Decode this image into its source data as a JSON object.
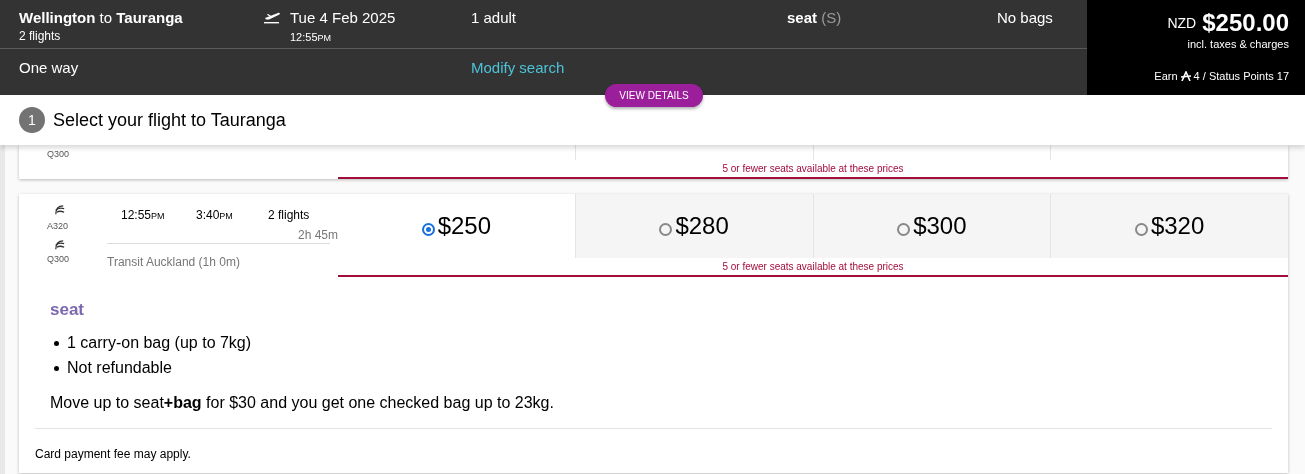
{
  "summary": {
    "origin": "Wellington",
    "connector": "to",
    "destination": "Tauranga",
    "flights_count": "2 flights",
    "date": "Tue 4 Feb 2025",
    "time": "12:55",
    "period": "PM",
    "passengers": "1 adult",
    "fare_name": "seat",
    "fare_code": "(S)",
    "bags": "No bags",
    "trip_type": "One way",
    "modify_link": "Modify search"
  },
  "price": {
    "currency": "NZD",
    "amount": "$250.00",
    "note": "incl. taxes & charges",
    "earn_prefix": "Earn",
    "earn_text": "4 / Status Points 17"
  },
  "view_details": "VIEW DETAILS",
  "step": {
    "number": "1",
    "title": "Select your flight to Tauranga"
  },
  "flights": [
    {
      "aircraft": [
        "Q300"
      ],
      "warning": "5 or fewer seats available at these prices"
    },
    {
      "aircraft": [
        "A320",
        "Q300"
      ],
      "depart": {
        "time": "12:55",
        "period": "PM"
      },
      "arrive": {
        "time": "3:40",
        "period": "PM"
      },
      "stops": "2 flights",
      "duration": "2h 45m",
      "transit": "Transit Auckland (1h 0m)",
      "fares": [
        {
          "price": "$250",
          "selected": true
        },
        {
          "price": "$280",
          "selected": false
        },
        {
          "price": "$300",
          "selected": false
        },
        {
          "price": "$320",
          "selected": false
        }
      ],
      "warning": "5 or fewer seats available at these prices",
      "details": {
        "fare_name": "seat",
        "features": [
          "1 carry-on bag (up to 7kg)",
          "Not refundable"
        ],
        "upsell": "Move up to seat**+bag** for $30 and you get one checked bag up to 23kg.",
        "footnote": "Card payment fee may apply."
      }
    }
  ]
}
